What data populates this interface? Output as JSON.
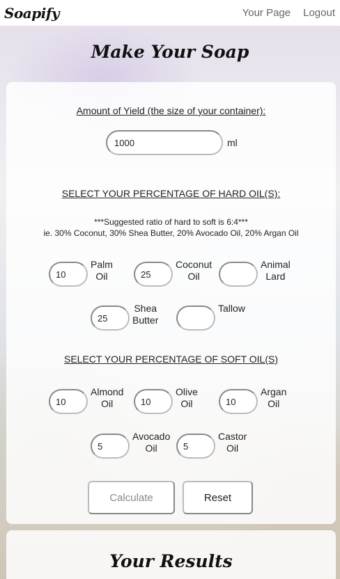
{
  "nav": {
    "brand": "Soapify",
    "your_page": "Your Page",
    "logout": "Logout"
  },
  "page_title": "Make Your Soap",
  "yield": {
    "heading": "Amount of Yield (the size of your container):",
    "value": "1000",
    "unit": "ml"
  },
  "hard_oils": {
    "heading": "SELECT YOUR PERCENTAGE OF HARD OIL(S):",
    "note_line1": "***Suggested ratio of hard to soft is 6:4***",
    "note_line2": "ie. 30% Coconut, 30% Shea Butter, 20% Avocado Oil, 20% Argan Oil",
    "palm": {
      "label_1": "Palm",
      "label_2": "Oil",
      "value": "10"
    },
    "coconut": {
      "label_1": "Coconut",
      "label_2": "Oil",
      "value": "25"
    },
    "animal_lard": {
      "label_1": "Animal",
      "label_2": "Lard",
      "value": ""
    },
    "shea": {
      "label_1": "Shea",
      "label_2": "Butter",
      "value": "25"
    },
    "tallow": {
      "label_1": "Tallow",
      "label_2": "",
      "value": ""
    }
  },
  "soft_oils": {
    "heading": "SELECT YOUR PERCENTAGE OF SOFT OIL(S)",
    "almond": {
      "label_1": "Almond",
      "label_2": "Oil",
      "value": "10"
    },
    "olive": {
      "label_1": "Olive",
      "label_2": "Oil",
      "value": "10"
    },
    "argan": {
      "label_1": "Argan",
      "label_2": "Oil",
      "value": "10"
    },
    "avocado": {
      "label_1": "Avocado",
      "label_2": "Oil",
      "value": "5"
    },
    "castor": {
      "label_1": "Castor",
      "label_2": "Oil",
      "value": "5"
    }
  },
  "buttons": {
    "calculate": "Calculate",
    "reset": "Reset"
  },
  "results_title": "Your Results"
}
